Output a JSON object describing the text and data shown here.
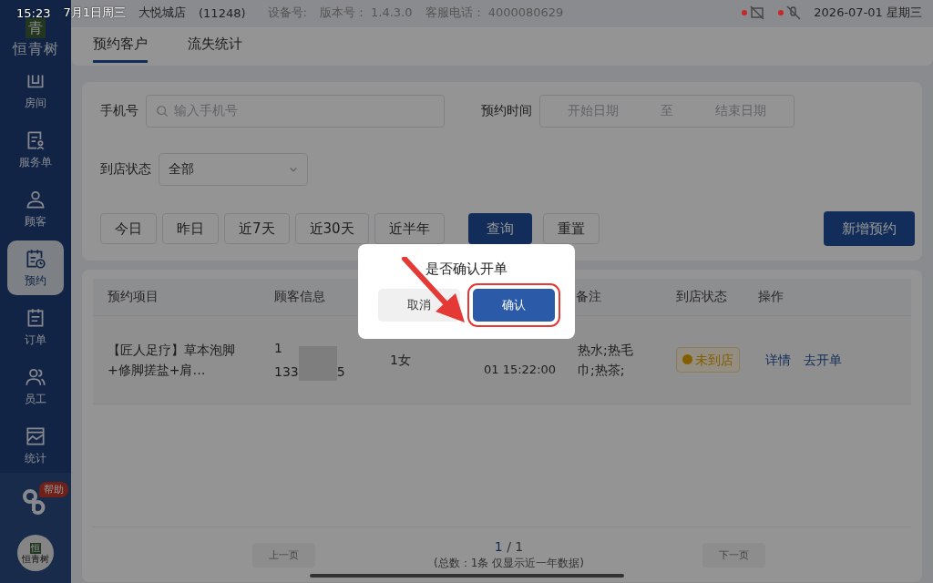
{
  "status_bar": {
    "time": "15:23",
    "date": "7月1日周三",
    "store": "大悦城店",
    "store_code": "(11248)",
    "device": "设备号:",
    "version": "版本号： 1.4.3.0",
    "hotline": "客服电话： 4000080629",
    "datetime": "2026-07-01 星期三"
  },
  "brand": {
    "mark": "青",
    "name": "恒青树"
  },
  "sidebar": {
    "items": [
      {
        "label": "房间",
        "selected": false
      },
      {
        "label": "服务单",
        "selected": false
      },
      {
        "label": "顾客",
        "selected": false
      },
      {
        "label": "预约",
        "selected": true
      },
      {
        "label": "订单",
        "selected": false
      },
      {
        "label": "员工",
        "selected": false
      },
      {
        "label": "统计",
        "selected": false
      }
    ],
    "help_badge": "帮助",
    "avatar": {
      "mark": "恒",
      "name": "恒青树"
    }
  },
  "tabs": [
    {
      "label": "预约客户",
      "selected": true
    },
    {
      "label": "流失统计",
      "selected": false
    }
  ],
  "filters": {
    "phone_label": "手机号",
    "phone_placeholder": "输入手机号",
    "time_label": "预约时间",
    "start_placeholder": "开始日期",
    "range_sep": "至",
    "end_placeholder": "结束日期",
    "status_label": "到店状态",
    "status_value": "全部"
  },
  "quick_ranges": [
    "今日",
    "昨日",
    "近7天",
    "近30天",
    "近半年"
  ],
  "query_button": "查询",
  "reset_button": "重置",
  "new_button": "新增预约",
  "table": {
    "columns": [
      "预约项目",
      "顾客信息",
      "备注",
      "到店状态",
      "操作"
    ],
    "rows": [
      {
        "project": "【匠人足疗】草本泡脚+修脚搓盐+肩…",
        "customer": [
          "1",
          "133",
          "5"
        ],
        "gender": "1女",
        "time": "01 15:22:00",
        "note": "热水;热毛巾;热茶;",
        "status": "未到店",
        "actions": [
          "详情",
          "去开单"
        ]
      }
    ]
  },
  "pagination": {
    "prev": "上一页",
    "current": "1",
    "separator": "/",
    "total": "1",
    "summary": "(总数：1条 仅显示近一年数据)",
    "next": "下一页"
  },
  "dialog": {
    "title": "是否确认开单",
    "cancel": "取消",
    "confirm": "确认"
  }
}
